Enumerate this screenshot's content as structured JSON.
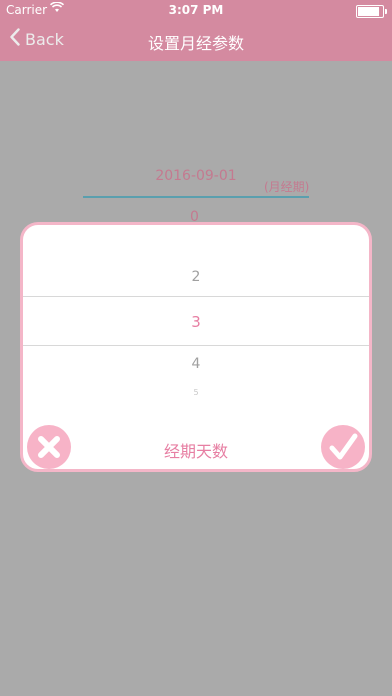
{
  "status_bar": {
    "carrier": "Carrier",
    "time": "3:07 PM"
  },
  "nav": {
    "back_label": "Back",
    "title": "设置月经参数"
  },
  "form": {
    "date_value": "2016-09-01",
    "date_hint": "(月经期)",
    "behind_value": "0"
  },
  "picker": {
    "options": [
      "2",
      "3",
      "4",
      "5"
    ],
    "selected": "3",
    "title": "经期天数"
  },
  "colors": {
    "nav_bg": "#d48aa0",
    "accent": "#e77fa3",
    "sheet_border": "#f4b6c8",
    "button_bg": "#f7b3c7"
  },
  "icons": {
    "back": "chevron-left-icon",
    "cancel": "close-icon",
    "confirm": "checkmark-icon"
  }
}
